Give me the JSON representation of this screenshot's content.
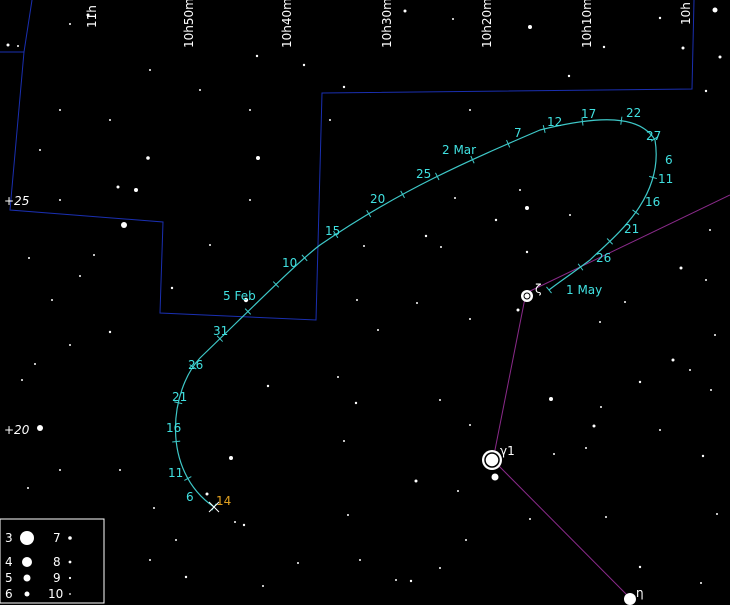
{
  "ra_labels": [
    "11h",
    "10h50m",
    "10h40m",
    "10h30m",
    "10h20m",
    "10h10m",
    "10h"
  ],
  "dec_labels": [
    "+25",
    "+20"
  ],
  "star_labels": {
    "zeta": "ζ",
    "gamma": "γ1",
    "eta": "η"
  },
  "path_dates": [
    "14",
    "6",
    "11",
    "16",
    "21",
    "26",
    "31",
    "5 Feb",
    "10",
    "15",
    "20",
    "25",
    "2 Mar",
    "7",
    "12",
    "17",
    "22",
    "27",
    "6",
    "11",
    "16",
    "21",
    "26",
    "1 May"
  ],
  "legend": {
    "magnitudes": [
      "3",
      "4",
      "5",
      "6",
      "7",
      "8",
      "9",
      "10"
    ]
  },
  "colors": {
    "background": "#000000",
    "path": "#3ec8c8",
    "path_label": "#40e0e0",
    "start_label": "#e0a020",
    "boundary": "#1a2fb0",
    "asterism": "#8a2a8a",
    "star": "#ffffff"
  }
}
